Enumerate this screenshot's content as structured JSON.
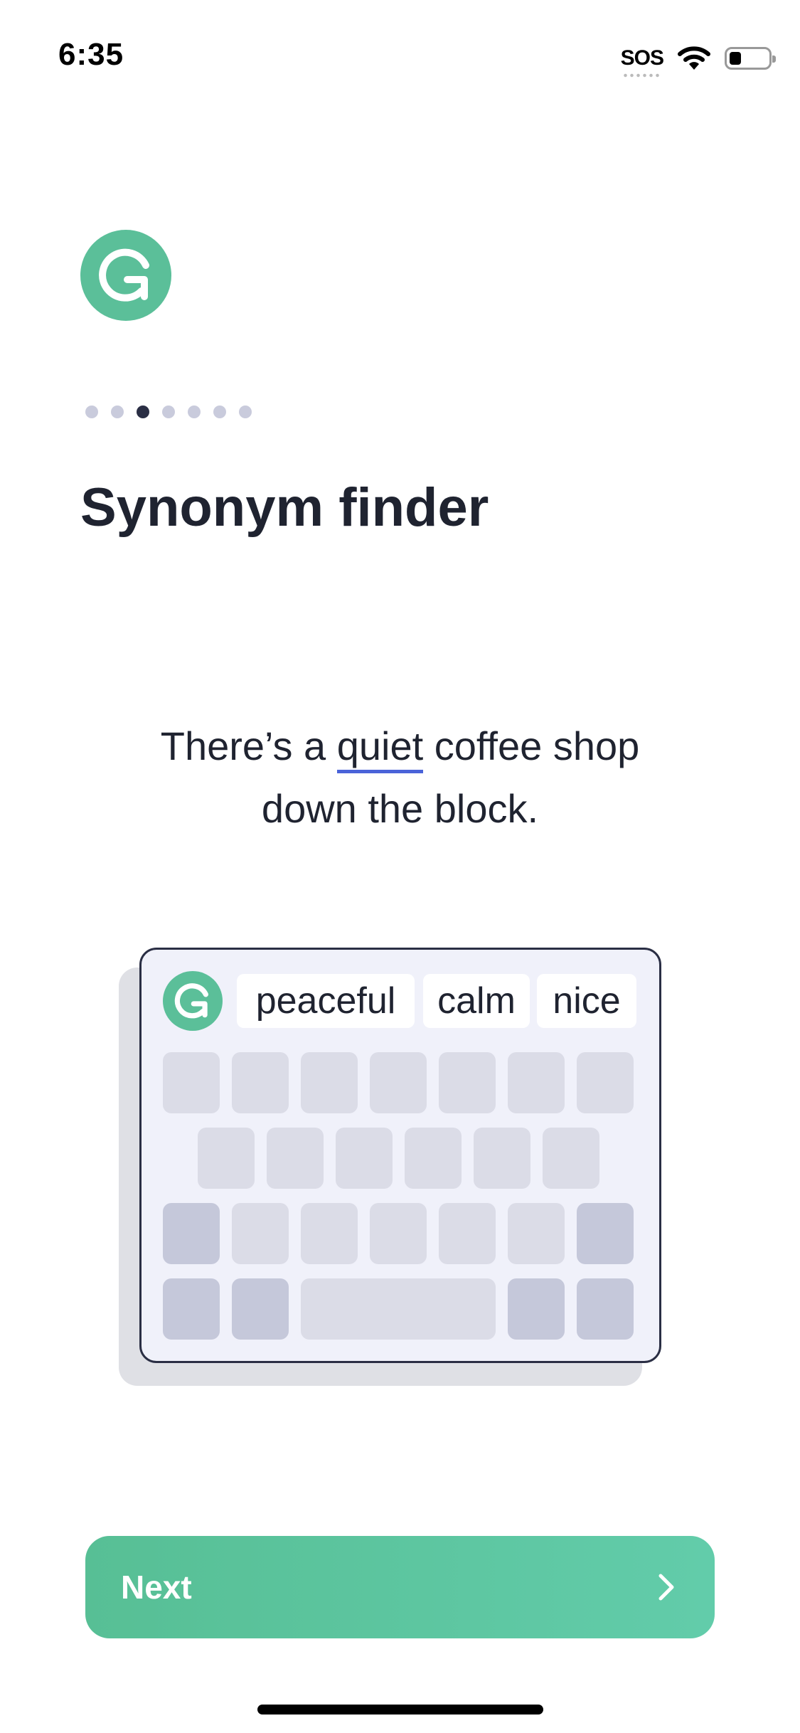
{
  "status_bar": {
    "time": "6:35",
    "sos": "SOS"
  },
  "onboarding": {
    "title": "Synonym finder",
    "page_indicator": {
      "total": 7,
      "active_index": 2
    },
    "sample_text": {
      "before": "There’s a ",
      "highlight": "quiet",
      "after": " coffee shop",
      "line2": "down the block."
    },
    "suggestions": [
      "peaceful",
      "calm",
      "nice"
    ]
  },
  "buttons": {
    "next_label": "Next"
  },
  "colors": {
    "brand": "#5bbf99",
    "underline": "#4a63d9",
    "text": "#1f2330"
  }
}
